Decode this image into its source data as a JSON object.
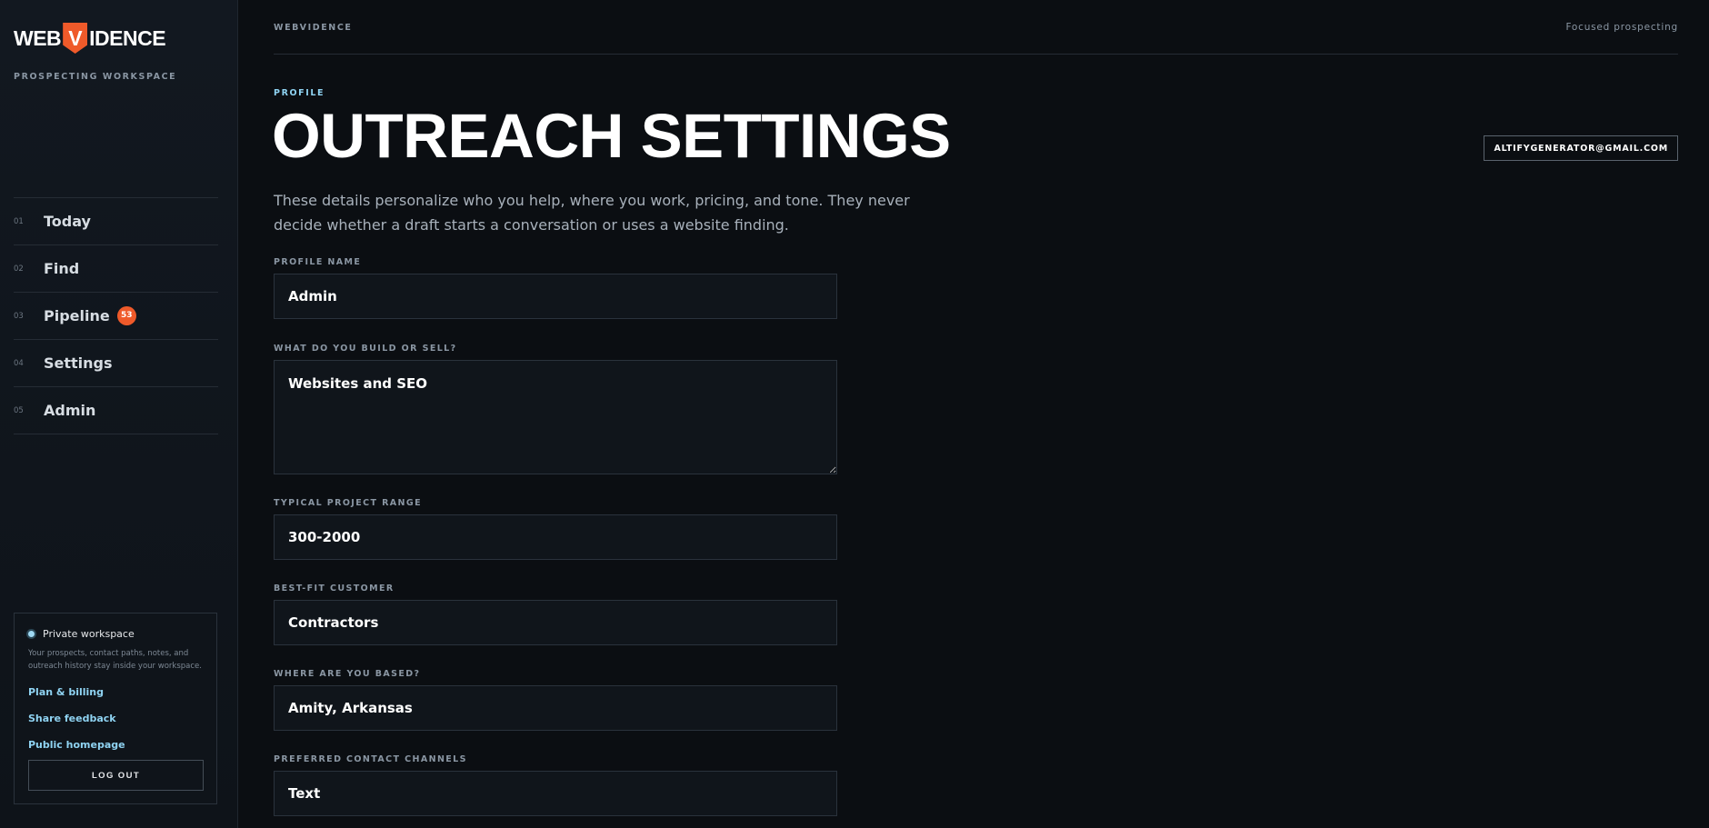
{
  "brand": {
    "logo_left": "WEB",
    "logo_mark": "V",
    "logo_right": "IDENCE",
    "subtitle": "PROSPECTING WORKSPACE"
  },
  "nav": [
    {
      "num": "01",
      "label": "Today"
    },
    {
      "num": "02",
      "label": "Find"
    },
    {
      "num": "03",
      "label": "Pipeline",
      "badge": "53"
    },
    {
      "num": "04",
      "label": "Settings"
    },
    {
      "num": "05",
      "label": "Admin"
    }
  ],
  "private": {
    "title": "Private workspace",
    "description": "Your prospects, contact paths, notes, and outreach history stay inside your workspace.",
    "links": {
      "billing": "Plan & billing",
      "feedback": "Share feedback",
      "homepage": "Public homepage"
    },
    "logout": "LOG OUT"
  },
  "topbar": {
    "left": "WEBVIDENCE",
    "right": "Focused prospecting"
  },
  "header": {
    "eyebrow": "PROFILE",
    "title": "OUTREACH SETTINGS",
    "user_email": "ALTIFYGENERATOR@GMAIL.COM",
    "intro": "These details personalize who you help, where you work, pricing, and tone. They never decide whether a draft starts a conversation or uses a website finding."
  },
  "form": {
    "profile_name": {
      "label": "PROFILE NAME",
      "value": "Admin"
    },
    "build_sell": {
      "label": "WHAT DO YOU BUILD OR SELL?",
      "value": "Websites and SEO"
    },
    "project_range": {
      "label": "TYPICAL PROJECT RANGE",
      "value": "300-2000"
    },
    "best_fit": {
      "label": "BEST-FIT CUSTOMER",
      "value": "Contractors"
    },
    "based": {
      "label": "WHERE ARE YOU BASED?",
      "value": "Amity, Arkansas"
    },
    "channels": {
      "label": "PREFERRED CONTACT CHANNELS",
      "value": "Text"
    }
  },
  "colors": {
    "accent": "#ef5a2a",
    "link": "#8fd3f2",
    "background": "#0b0e12"
  }
}
